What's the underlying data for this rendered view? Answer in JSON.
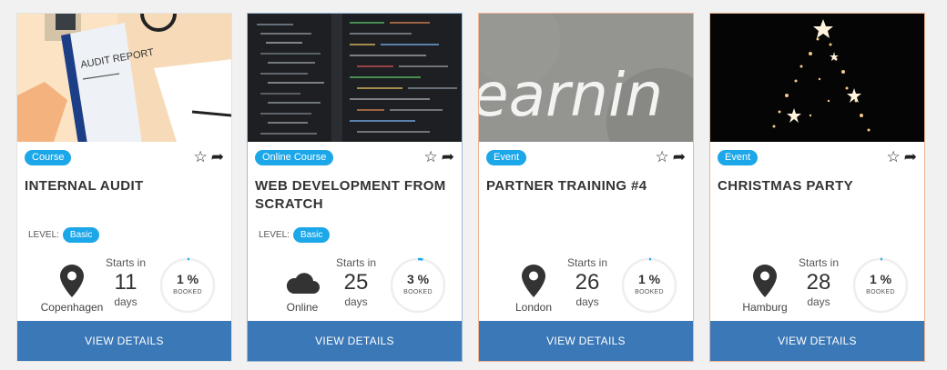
{
  "cards": [
    {
      "badge": "Course",
      "title": "INTERNAL AUDIT",
      "level_label": "LEVEL:",
      "level": "Basic",
      "location": "Copenhagen",
      "location_icon": "map-pin-icon",
      "starts_label": "Starts in",
      "days_number": "11",
      "days_label": "days",
      "percent": "1 %",
      "percent_value": 0.01,
      "booked_label": "BOOKED",
      "cta": "VIEW DETAILS",
      "image_text": "AUDIT REPORT"
    },
    {
      "badge": "Online Course",
      "title": "WEB DEVELOPMENT FROM SCRATCH",
      "level_label": "LEVEL:",
      "level": "Basic",
      "location": "Online",
      "location_icon": "cloud-icon",
      "starts_label": "Starts in",
      "days_number": "25",
      "days_label": "days",
      "percent": "3 %",
      "percent_value": 0.03,
      "booked_label": "BOOKED",
      "cta": "VIEW DETAILS"
    },
    {
      "badge": "Event",
      "title": "PARTNER TRAINING #4",
      "location": "London",
      "location_icon": "map-pin-icon",
      "starts_label": "Starts in",
      "days_number": "26",
      "days_label": "days",
      "percent": "1 %",
      "percent_value": 0.01,
      "booked_label": "BOOKED",
      "cta": "VIEW DETAILS",
      "image_text": "earnin"
    },
    {
      "badge": "Event",
      "title": "CHRISTMAS PARTY",
      "location": "Hamburg",
      "location_icon": "map-pin-icon",
      "starts_label": "Starts in",
      "days_number": "28",
      "days_label": "days",
      "percent": "1 %",
      "percent_value": 0.01,
      "booked_label": "BOOKED",
      "cta": "VIEW DETAILS"
    }
  ],
  "icons": {
    "favorite": "star-outline-icon",
    "share": "share-arrow-icon"
  },
  "colors": {
    "badge": "#1ba7e8",
    "cta": "#3b78b7",
    "donut_track": "#eeeeee",
    "donut_fill": "#1ba7e8"
  }
}
